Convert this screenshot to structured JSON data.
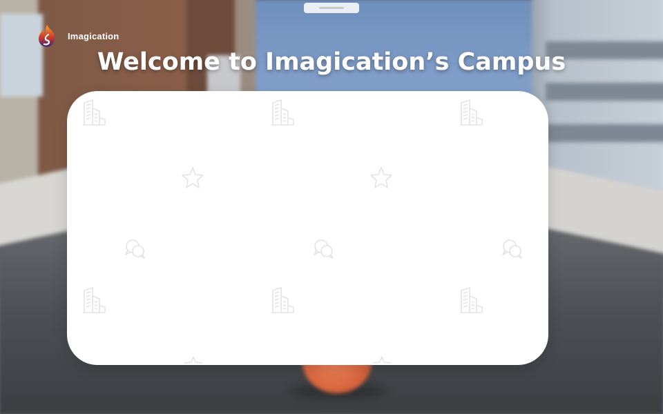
{
  "brand": {
    "name": "Imagication",
    "logo_icon": "flame-logo-icon"
  },
  "header": {
    "title": "Welcome to Imagication’s Campus"
  },
  "colors": {
    "panel_bg": "#ffffff",
    "title_text": "#ffffff",
    "pattern_icon": "#e6e6e6",
    "ball": "#e0714a"
  },
  "panel": {
    "pattern_icons": [
      "buildings-icon",
      "star-icon",
      "chat-bubbles-icon"
    ]
  }
}
